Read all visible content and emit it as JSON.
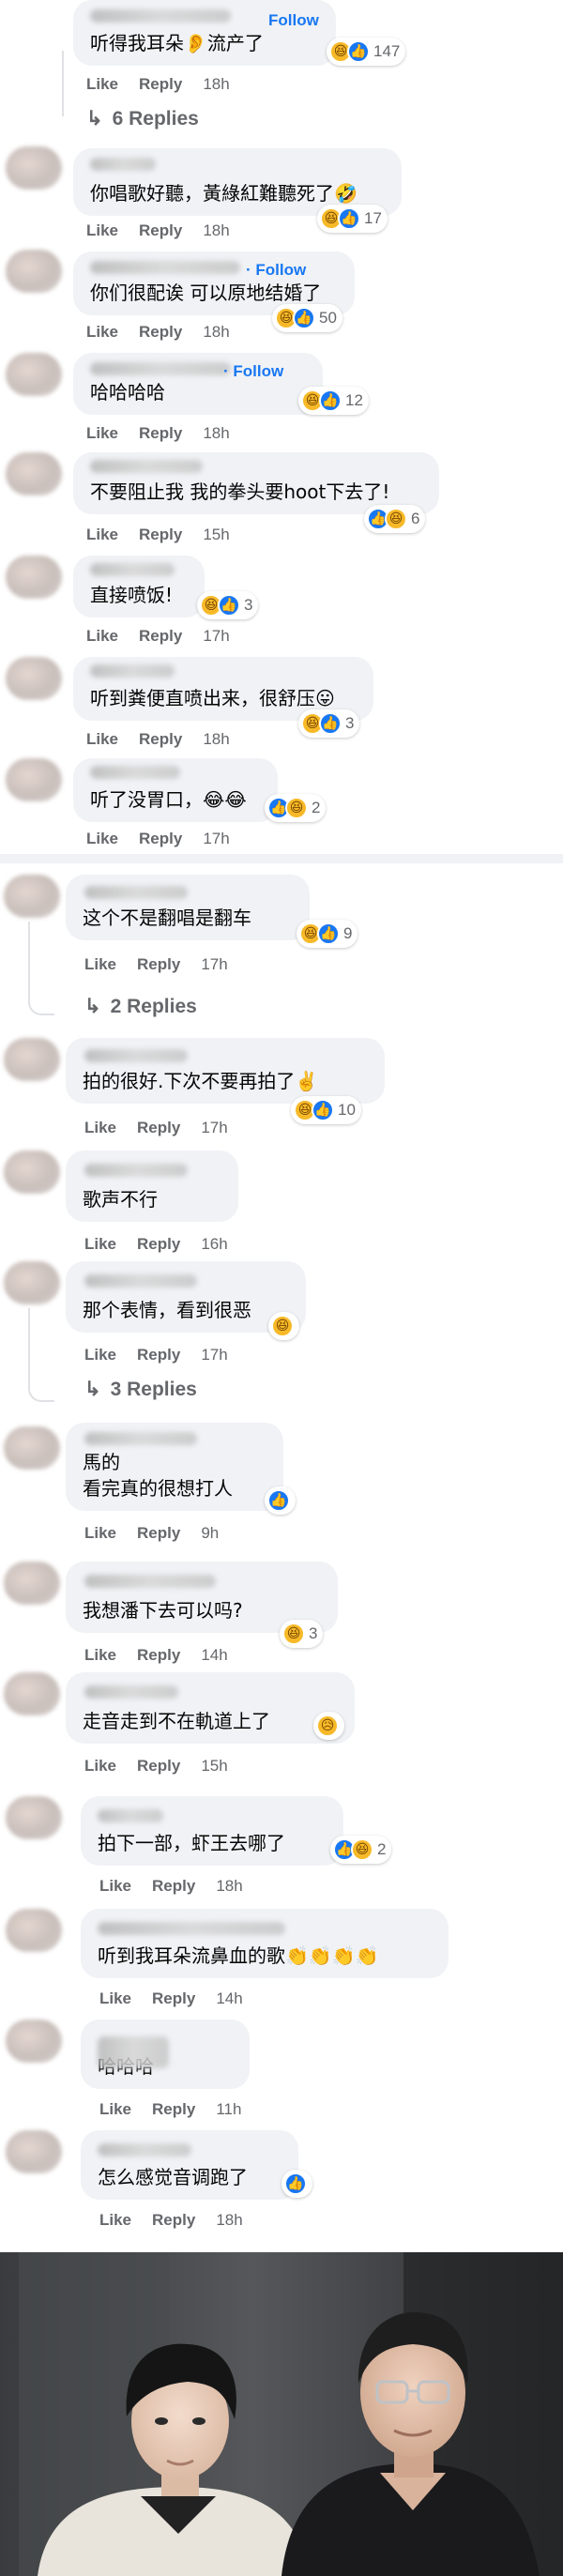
{
  "section_a": {
    "comments": [
      {
        "text": "听得我耳朵👂流产了",
        "follow": "Follow",
        "like": "Like",
        "reply": "Reply",
        "time": "18h",
        "reactions": [
          "haha",
          "like"
        ],
        "count": "147",
        "replies": "6 Replies"
      },
      {
        "text": "你唱歌好聽，黃綠紅難聽死了🤣",
        "like": "Like",
        "reply": "Reply",
        "time": "18h",
        "reactions": [
          "haha",
          "like"
        ],
        "count": "17"
      },
      {
        "text": "你们很配诶 可以原地结婚了",
        "follow": "· Follow",
        "like": "Like",
        "reply": "Reply",
        "time": "18h",
        "reactions": [
          "haha",
          "like"
        ],
        "count": "50"
      },
      {
        "text": "哈哈哈哈",
        "follow": "· Follow",
        "like": "Like",
        "reply": "Reply",
        "time": "18h",
        "reactions": [
          "haha",
          "like"
        ],
        "count": "12"
      },
      {
        "text": "不要阻止我 我的拳头要hoot下去了!",
        "like": "Like",
        "reply": "Reply",
        "time": "15h",
        "reactions": [
          "like",
          "haha"
        ],
        "count": "6"
      },
      {
        "text": "直接喷饭!",
        "like": "Like",
        "reply": "Reply",
        "time": "17h",
        "reactions": [
          "haha",
          "like"
        ],
        "count": "3"
      },
      {
        "text": "听到粪便直喷出来，很舒压😛",
        "like": "Like",
        "reply": "Reply",
        "time": "18h",
        "reactions": [
          "haha",
          "like"
        ],
        "count": "3"
      },
      {
        "text": "听了没胃口，😂😂",
        "like": "Like",
        "reply": "Reply",
        "time": "17h",
        "reactions": [
          "like",
          "haha"
        ],
        "count": "2"
      }
    ]
  },
  "section_b": {
    "comments": [
      {
        "text": "这个不是翻唱是翻车",
        "like": "Like",
        "reply": "Reply",
        "time": "17h",
        "reactions": [
          "haha",
          "like"
        ],
        "count": "9",
        "replies": "2 Replies"
      },
      {
        "text": "拍的很好.下次不要再拍了✌️",
        "like": "Like",
        "reply": "Reply",
        "time": "17h",
        "reactions": [
          "haha",
          "like"
        ],
        "count": "10"
      },
      {
        "text": "歌声不行",
        "like": "Like",
        "reply": "Reply",
        "time": "16h"
      },
      {
        "text": "那个表情，看到很恶",
        "like": "Like",
        "reply": "Reply",
        "time": "17h",
        "reactions": [
          "haha"
        ],
        "count": "",
        "replies": "3 Replies"
      },
      {
        "text": "馬的\n看完真的很想打人",
        "like": "Like",
        "reply": "Reply",
        "time": "9h",
        "reactions": [
          "like"
        ],
        "count": ""
      },
      {
        "text": "我想潘下去可以吗?",
        "like": "Like",
        "reply": "Reply",
        "time": "14h",
        "reactions": [
          "haha"
        ],
        "count": "3"
      },
      {
        "text": "走音走到不在軌道上了",
        "like": "Like",
        "reply": "Reply",
        "time": "15h",
        "reactions": [
          "sad"
        ],
        "count": ""
      },
      {
        "text": "拍下一部，虾王去哪了",
        "like": "Like",
        "reply": "Reply",
        "time": "18h",
        "reactions": [
          "like",
          "haha"
        ],
        "count": "2"
      },
      {
        "text": "听到我耳朵流鼻血的歌👏👏👏👏",
        "like": "Like",
        "reply": "Reply",
        "time": "14h"
      },
      {
        "text": "哈哈哈",
        "like": "Like",
        "reply": "Reply",
        "time": "11h"
      },
      {
        "text": "怎么感觉音调跑了",
        "like": "Like",
        "reply": "Reply",
        "time": "18h",
        "reactions": [
          "like"
        ],
        "count": ""
      }
    ]
  },
  "icons": {
    "haha": "😆",
    "like": "👍",
    "sad": "😥"
  },
  "colors": {
    "bubble": "#f0f2f5",
    "link": "#1877f2",
    "meta": "#65676b",
    "like_reaction": "#1877f2",
    "haha_reaction": "#f7b928"
  },
  "photo": {
    "subject": "two-people-selfie"
  }
}
